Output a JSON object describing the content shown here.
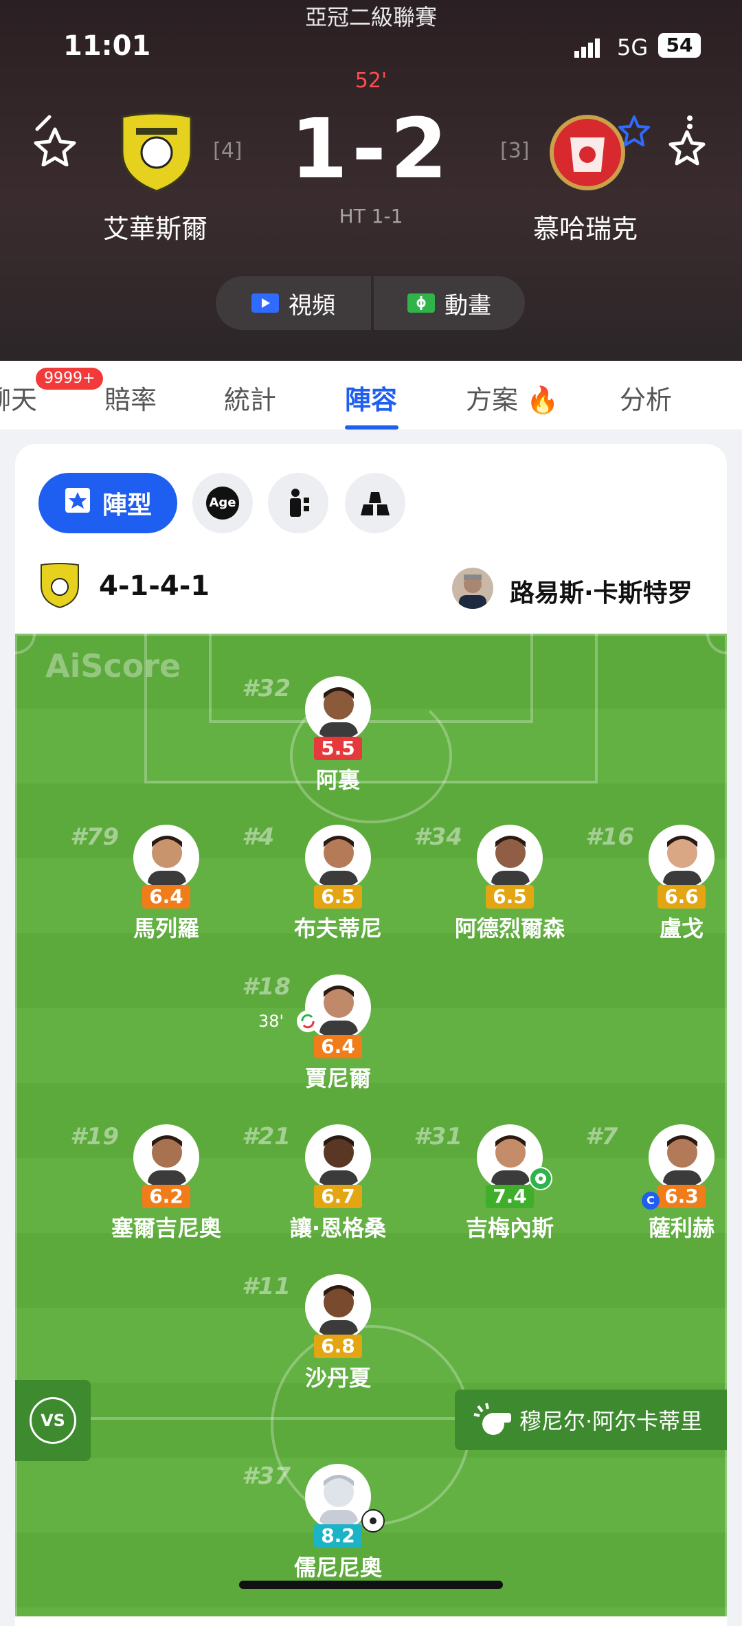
{
  "status": {
    "time": "11:01",
    "network": "5G",
    "battery": "54"
  },
  "match": {
    "league": "亞冠二級聯賽",
    "minute": "52'",
    "score": "1-2",
    "half_time": "HT 1-1",
    "home": {
      "name": "艾華斯爾",
      "rank": "[4]"
    },
    "away": {
      "name": "慕哈瑞克",
      "rank": "[3]"
    },
    "video_label": "視頻",
    "animation_label": "動畫"
  },
  "tabs": {
    "chat": "聊天",
    "chat_badge": "9999+",
    "odds": "賠率",
    "stats": "統計",
    "lineup": "陣容",
    "plans": "方案",
    "analysis": "分析"
  },
  "lineup": {
    "formation_button": "陣型",
    "age_button": "Age",
    "formation": "4-1-4-1",
    "coach": "路易斯·卡斯特罗",
    "watermark": "AiScore",
    "vs_label": "VS",
    "referee": "穆尼尔·阿尔卡蒂里",
    "sub_minute": "38'",
    "players": [
      {
        "num": "#32",
        "name": "阿裏",
        "rating": "5.5",
        "color": "#e5393b"
      },
      {
        "num": "#79",
        "name": "馬列羅",
        "rating": "6.4",
        "color": "#f07c1a"
      },
      {
        "num": "#4",
        "name": "布夫蒂尼",
        "rating": "6.5",
        "color": "#e3a612"
      },
      {
        "num": "#34",
        "name": "阿德烈爾森",
        "rating": "6.5",
        "color": "#e3a612"
      },
      {
        "num": "#16",
        "name": "盧戈",
        "rating": "6.6",
        "color": "#e3a612"
      },
      {
        "num": "#18",
        "name": "賈尼爾",
        "rating": "6.4",
        "color": "#f07c1a"
      },
      {
        "num": "#19",
        "name": "塞爾吉尼奧",
        "rating": "6.2",
        "color": "#f07c1a"
      },
      {
        "num": "#21",
        "name": "讓·恩格桑",
        "rating": "6.7",
        "color": "#e3a612"
      },
      {
        "num": "#31",
        "name": "吉梅內斯",
        "rating": "7.4",
        "color": "#3fae2a"
      },
      {
        "num": "#7",
        "name": "薩利赫",
        "rating": "6.3",
        "color": "#f07c1a"
      },
      {
        "num": "#11",
        "name": "沙丹夏",
        "rating": "6.8",
        "color": "#e3a612"
      },
      {
        "num": "#37",
        "name": "儒尼尼奧",
        "rating": "8.2",
        "color": "#1cb3c7"
      }
    ]
  }
}
